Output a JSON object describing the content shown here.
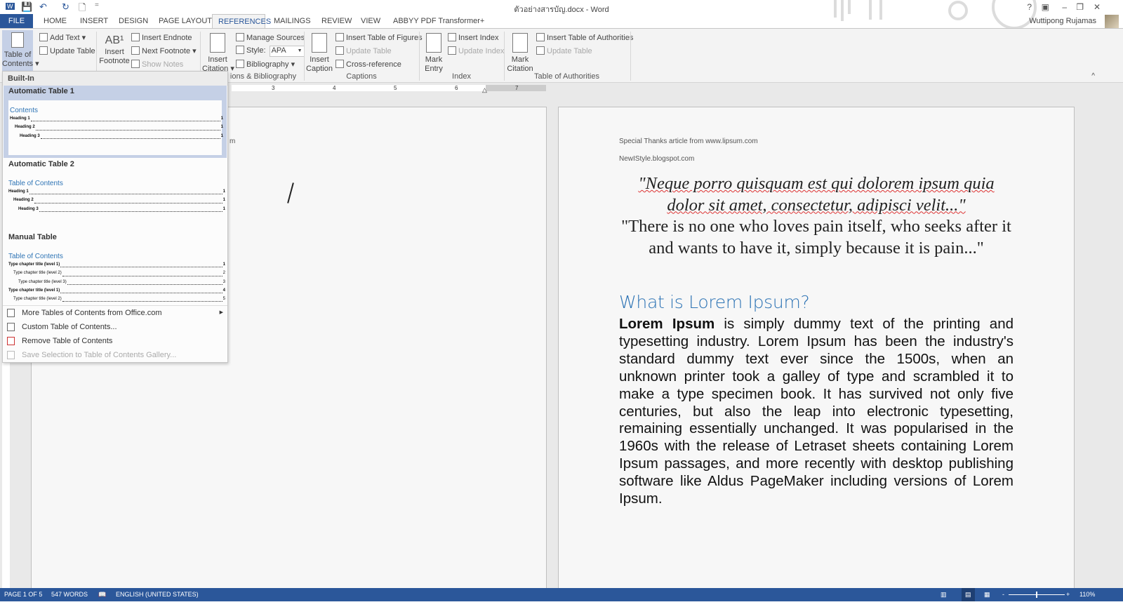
{
  "window": {
    "title": "ตัวอย่างสารบัญ.docx - Word",
    "user": "Wuttipong Rujamas",
    "help": "?",
    "minimize": "–",
    "restore": "❐",
    "close": "✕"
  },
  "quick_access": {
    "save": "💾",
    "undo": "↶",
    "redo": "↻",
    "new": "🗋",
    "customize": "="
  },
  "tabs": [
    "FILE",
    "HOME",
    "INSERT",
    "DESIGN",
    "PAGE LAYOUT",
    "REFERENCES",
    "MAILINGS",
    "REVIEW",
    "VIEW",
    "ABBYY PDF Transformer+"
  ],
  "ribbon": {
    "toc": {
      "label1": "Table of",
      "label2": "Contents ▾",
      "add_text": "Add Text ▾",
      "update_table": "Update Table"
    },
    "footnotes": {
      "insert_footnote1": "Insert",
      "insert_footnote2": "Footnote",
      "ab": "AB¹",
      "insert_endnote": "Insert Endnote",
      "next_footnote": "Next Footnote ▾",
      "show_notes": "Show Notes"
    },
    "citations": {
      "insert_citation1": "Insert",
      "insert_citation2": "Citation ▾",
      "manage_sources": "Manage Sources",
      "style_label": "Style:",
      "style_value": "APA",
      "bibliography": "Bibliography ▾",
      "group": "ions & Bibliography"
    },
    "captions": {
      "insert_caption1": "Insert",
      "insert_caption2": "Caption",
      "insert_tof": "Insert Table of Figures",
      "update_table": "Update Table",
      "cross_reference": "Cross-reference",
      "group": "Captions"
    },
    "index": {
      "mark_entry1": "Mark",
      "mark_entry2": "Entry",
      "insert_index": "Insert Index",
      "update_index": "Update Index",
      "group": "Index"
    },
    "toa": {
      "mark_citation1": "Mark",
      "mark_citation2": "Citation",
      "insert_toa": "Insert Table of Authorities",
      "update_table": "Update Table",
      "group": "Table of Authorities"
    },
    "collapse": "^"
  },
  "ruler": {
    "ticks": [
      "3",
      "4",
      "5",
      "6",
      "7"
    ]
  },
  "menu": {
    "section": "Built-In",
    "auto1": {
      "title": "Automatic Table 1",
      "heading": "Contents",
      "rows": [
        [
          "Heading 1",
          "1"
        ],
        [
          "Heading 2",
          "1"
        ],
        [
          "Heading 3",
          "1"
        ]
      ]
    },
    "auto2": {
      "title": "Automatic Table 2",
      "heading": "Table of Contents",
      "rows": [
        [
          "Heading 1",
          "1"
        ],
        [
          "Heading 2",
          "1"
        ],
        [
          "Heading 3",
          "1"
        ]
      ]
    },
    "manual": {
      "title": "Manual Table",
      "heading": "Table of Contents",
      "rows": [
        [
          "Type chapter title (level 1)",
          "1"
        ],
        [
          "Type chapter title (level 2)",
          "2"
        ],
        [
          "Type chapter title (level 3)",
          "3"
        ],
        [
          "Type chapter title (level 1)",
          "4"
        ],
        [
          "Type chapter title (level 2)",
          "5"
        ]
      ]
    },
    "items": [
      "More Tables of Contents from Office.com",
      "Custom Table of Contents...",
      "Remove Table of Contents",
      "Save Selection to Table of Contents Gallery..."
    ]
  },
  "left_page": {
    "fragment": "m"
  },
  "right_page": {
    "credit1": "Special Thanks article from www.lipsum.com",
    "credit2": "NewIStyle.blogspot.com",
    "quote_latin": "\"Neque porro quisquam est qui dolorem ipsum quia dolor sit amet, consectetur, adipisci velit...\"",
    "quote_english": "\"There is no one who loves pain itself, who seeks after it and wants to have it, simply because it is pain...\"",
    "heading": "What is Lorem Ipsum?",
    "body_bold": "Lorem Ipsum",
    "body": " is simply dummy text of the printing and typesetting industry. Lorem Ipsum has been the industry's standard dummy text ever since the 1500s, when an unknown printer took a galley of type and scrambled it to make a type specimen book. It has survived not only five centuries, but also the leap into electronic typesetting, remaining essentially unchanged. It was popularised in the 1960s with the release of Letraset sheets containing Lorem Ipsum passages, and more recently with desktop publishing software like Aldus PageMaker including versions of Lorem Ipsum."
  },
  "status": {
    "page": "PAGE 1 OF 5",
    "words": "547 WORDS",
    "language": "ENGLISH (UNITED STATES)",
    "zoom": "110%",
    "zoom_minus": "-",
    "zoom_plus": "+"
  },
  "colors": {
    "accent": "#2b579a",
    "heading": "#2e74b5",
    "selection": "#c5d0e6"
  }
}
